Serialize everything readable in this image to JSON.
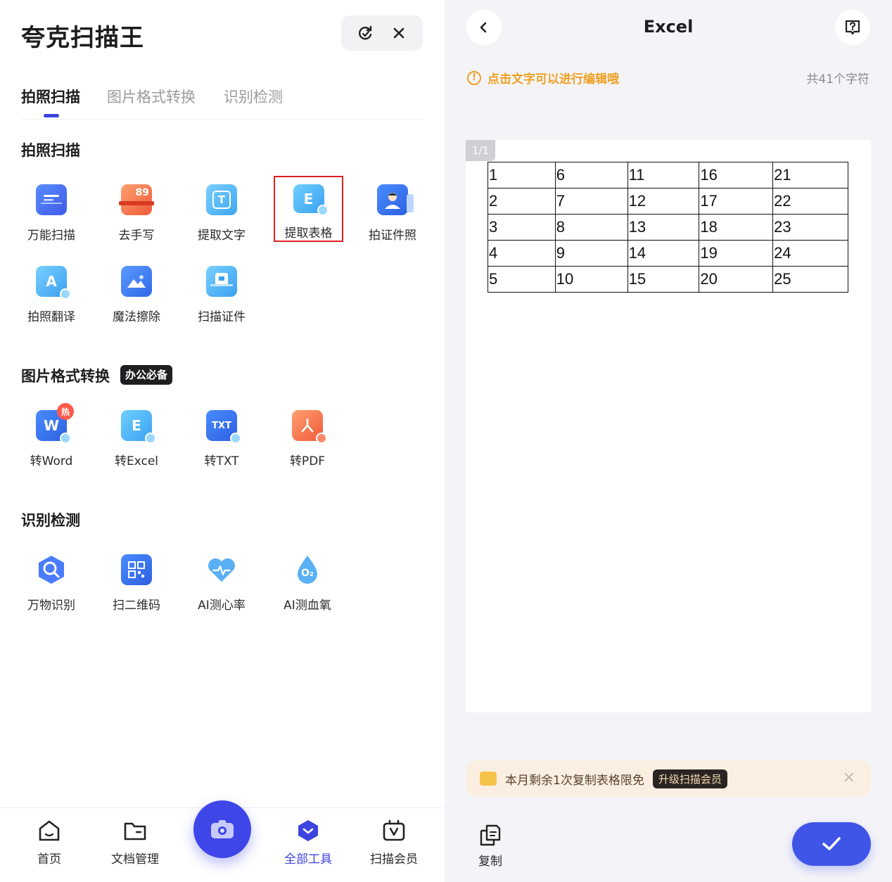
{
  "left": {
    "app_title": "夸克扫描王",
    "tabs": [
      {
        "label": "拍照扫描"
      },
      {
        "label": "图片格式转换"
      },
      {
        "label": "识别检测"
      }
    ],
    "sections": {
      "photo_scan": {
        "title": "拍照扫描",
        "tools": [
          {
            "label": "万能扫描",
            "icon": "universal-scan-icon"
          },
          {
            "label": "去手写",
            "icon": "remove-handwriting-icon"
          },
          {
            "label": "提取文字",
            "icon": "extract-text-icon"
          },
          {
            "label": "提取表格",
            "icon": "extract-table-icon"
          },
          {
            "label": "拍证件照",
            "icon": "id-photo-icon"
          },
          {
            "label": "拍照翻译",
            "icon": "photo-translate-icon"
          },
          {
            "label": "魔法擦除",
            "icon": "magic-erase-icon"
          },
          {
            "label": "扫描证件",
            "icon": "scan-document-icon"
          }
        ]
      },
      "format_convert": {
        "title": "图片格式转换",
        "badge": "办公必备",
        "tools": [
          {
            "label": "转Word",
            "icon": "word-icon",
            "corner": "热"
          },
          {
            "label": "转Excel",
            "icon": "excel-icon"
          },
          {
            "label": "转TXT",
            "icon": "txt-icon",
            "icon_text": "TXT"
          },
          {
            "label": "转PDF",
            "icon": "pdf-icon"
          }
        ]
      },
      "detect": {
        "title": "识别检测",
        "tools": [
          {
            "label": "万物识别",
            "icon": "object-recognition-icon"
          },
          {
            "label": "扫二维码",
            "icon": "qr-code-icon"
          },
          {
            "label": "AI测心率",
            "icon": "heart-rate-icon"
          },
          {
            "label": "AI测血氧",
            "icon": "blood-oxygen-icon",
            "icon_text": "O₂"
          }
        ]
      }
    },
    "nav": [
      {
        "label": "首页",
        "icon": "home-icon"
      },
      {
        "label": "文档管理",
        "icon": "folder-icon"
      },
      {
        "label": "全部工具",
        "icon": "all-tools-icon"
      },
      {
        "label": "扫描会员",
        "icon": "vip-icon"
      }
    ],
    "extract_icon_letter": "E",
    "remove_handwriting_num": "89",
    "extract_text_letter": "T",
    "translate_letter": "A"
  },
  "right": {
    "title": "Excel",
    "hint": "点击文字可以进行编辑哦",
    "char_count": "共41个字符",
    "page_tag": "1/1",
    "table": [
      [
        "1",
        "6",
        "11",
        "16",
        "21"
      ],
      [
        "2",
        "7",
        "12",
        "17",
        "22"
      ],
      [
        "3",
        "8",
        "13",
        "18",
        "23"
      ],
      [
        "4",
        "9",
        "14",
        "19",
        "24"
      ],
      [
        "5",
        "10",
        "15",
        "20",
        "25"
      ]
    ],
    "promo": {
      "text": "本月剩余1次复制表格限免",
      "badge": "升级扫描会员"
    },
    "copy_label": "复制"
  },
  "colors": {
    "accent": "#3d44e0",
    "warning": "#f0a020",
    "highlight": "#e02020"
  }
}
